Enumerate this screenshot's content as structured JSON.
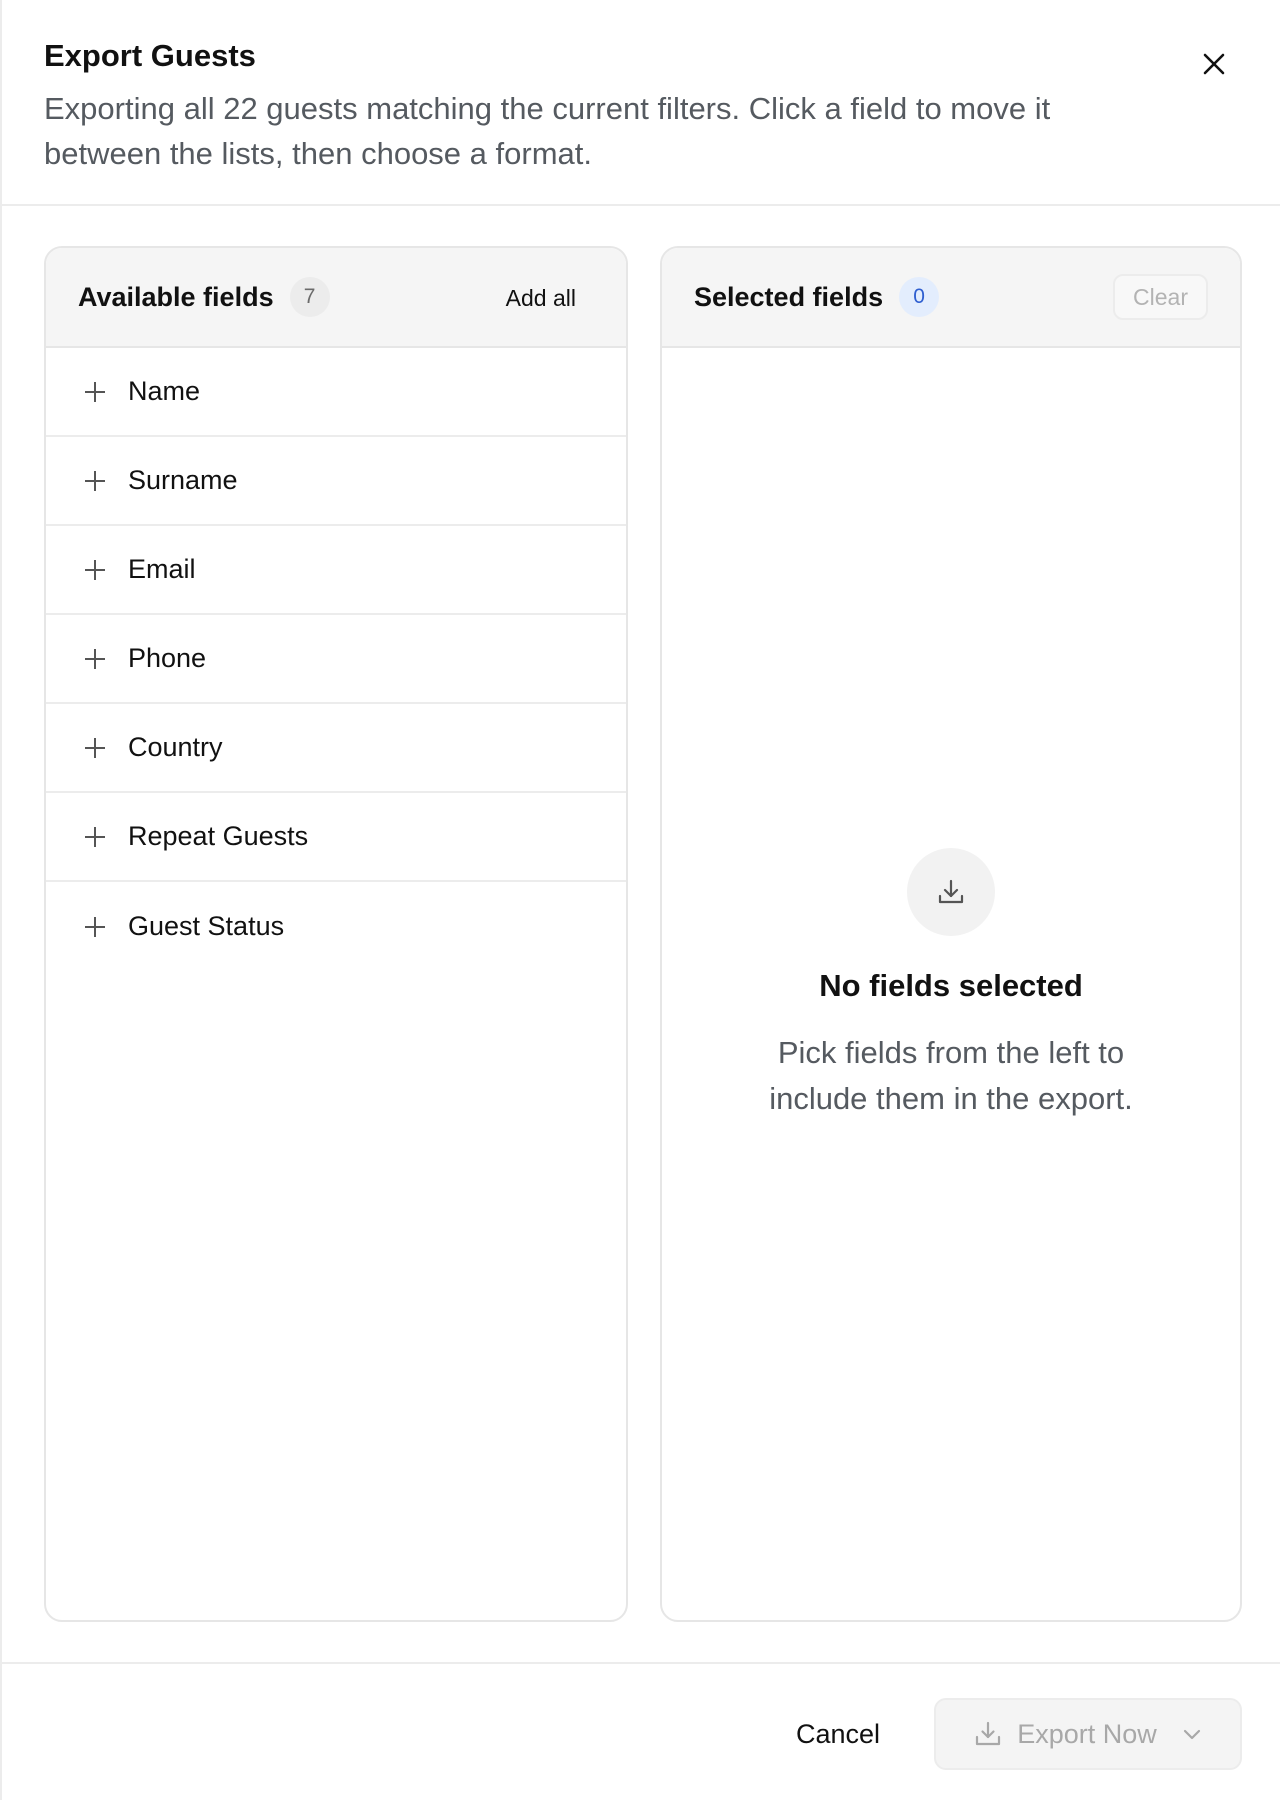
{
  "modal": {
    "title": "Export Guests",
    "description": "Exporting all 22 guests matching the current filters. Click a field to move it between the lists, then choose a format."
  },
  "available": {
    "title": "Available fields",
    "count": "7",
    "add_all_label": "Add all",
    "fields": [
      {
        "label": "Name"
      },
      {
        "label": "Surname"
      },
      {
        "label": "Email"
      },
      {
        "label": "Phone"
      },
      {
        "label": "Country"
      },
      {
        "label": "Repeat Guests"
      },
      {
        "label": "Guest Status"
      }
    ]
  },
  "selected": {
    "title": "Selected fields",
    "count": "0",
    "clear_label": "Clear",
    "empty_title": "No fields selected",
    "empty_description": "Pick fields from the left to include them in the export."
  },
  "footer": {
    "cancel_label": "Cancel",
    "export_label": "Export Now"
  },
  "icons": {
    "close": "close-icon",
    "add": "plus-icon",
    "download": "download-icon",
    "dropdown": "chevron-down-icon"
  },
  "colors": {
    "selected_badge_bg": "#e3edfd",
    "selected_badge_text": "#2f5fd0",
    "disabled_text": "#a8a8a8"
  }
}
